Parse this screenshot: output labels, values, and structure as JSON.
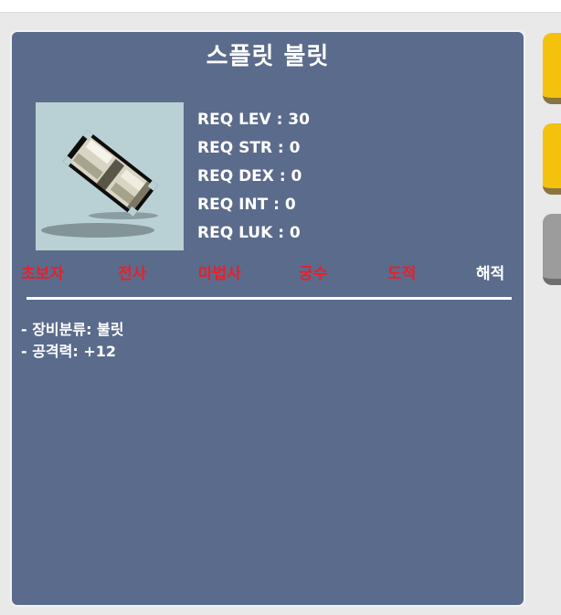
{
  "item": {
    "name": "스플릿 불릿"
  },
  "requirements": [
    {
      "label": "REQ LEV : 30"
    },
    {
      "label": "REQ STR : 0"
    },
    {
      "label": "REQ DEX : 0"
    },
    {
      "label": "REQ INT : 0"
    },
    {
      "label": "REQ LUK : 0"
    }
  ],
  "jobs": [
    {
      "label": "초보자",
      "color": "#e8202a"
    },
    {
      "label": "전사",
      "color": "#e8202a"
    },
    {
      "label": "마법사",
      "color": "#e8202a"
    },
    {
      "label": "궁수",
      "color": "#e8202a"
    },
    {
      "label": "도적",
      "color": "#e8202a"
    },
    {
      "label": "해적",
      "color": "#ffffff"
    }
  ],
  "stats": [
    {
      "label": "- 장비분류: 불릿"
    },
    {
      "label": "- 공격력: +12"
    }
  ],
  "colors": {
    "card_background": "#5b6b8c",
    "job_unavailable": "#e8202a",
    "job_available": "#ffffff",
    "tab_accent": "#f4c20d"
  },
  "icons": {
    "item": "bullet-icon"
  }
}
